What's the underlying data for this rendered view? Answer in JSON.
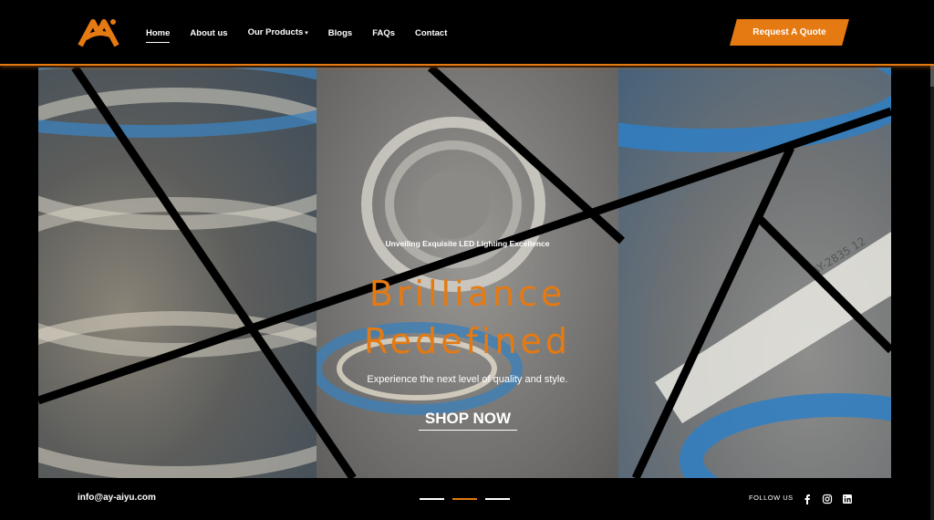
{
  "brand": {
    "name": "AIYU",
    "accent": "#e57a12"
  },
  "nav": {
    "items": [
      {
        "label": "Home",
        "active": true
      },
      {
        "label": "About us"
      },
      {
        "label": "Our Products",
        "has_dropdown": true
      },
      {
        "label": "Blogs"
      },
      {
        "label": "FAQs"
      },
      {
        "label": "Contact"
      }
    ],
    "quote_button": "Request A Quote"
  },
  "hero": {
    "subtitle": "Unveiling Exquisite LED Lighting Excellence",
    "title_line1": "Brilliance",
    "title_line2": "Redefined",
    "description": "Experience the next level of quality and style.",
    "cta": "SHOP NOW",
    "strip_print": "AY-2835 12"
  },
  "footer": {
    "email": "info@ay-aiyu.com",
    "follow_label": "FOLLOW US",
    "social_icons": [
      "facebook-icon",
      "instagram-icon",
      "linkedin-icon"
    ],
    "slide_count": 3,
    "active_slide": 2
  }
}
